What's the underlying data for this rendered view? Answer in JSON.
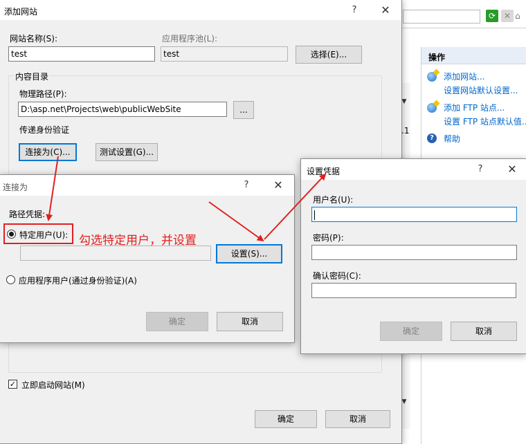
{
  "add_site": {
    "title": "添加网站",
    "help": "?",
    "close": "✕",
    "site_name_label": "网站名称(S):",
    "site_name_value": "test",
    "app_pool_label": "应用程序池(L):",
    "app_pool_value": "test",
    "select_button": "选择(E)...",
    "content_dir_label": "内容目录",
    "physical_path_label": "物理路径(P):",
    "physical_path_value": "D:\\asp.net\\Projects\\web\\publicWebSite",
    "browse_button": "...",
    "pass_auth_label": "传递身份验证",
    "connect_as_button": "连接为(C)...",
    "test_settings_button": "测试设置(G)...",
    "start_now_label": "立即启动网站(M)",
    "ok_button": "确定",
    "cancel_button": "取消"
  },
  "connect_as": {
    "title": "连接为",
    "help": "?",
    "close": "✕",
    "path_cred_label": "路径凭据:",
    "specific_user_label": "特定用户(U):",
    "set_button": "设置(S)...",
    "app_user_label": "应用程序用户(通过身份验证)(A)",
    "ok_button": "确定",
    "cancel_button": "取消"
  },
  "set_credentials": {
    "title": "设置凭据",
    "help": "?",
    "close": "✕",
    "username_label": "用户名(U):",
    "password_label": "密码(P):",
    "confirm_password_label": "确认密码(C):",
    "ok_button": "确定",
    "cancel_button": "取消"
  },
  "annotation": {
    "text": "勾选特定用户，并设置",
    "color": "#e02020"
  },
  "actions_pane": {
    "header": "操作",
    "add_site": "添加网站...",
    "set_site_defaults": "设置网站默认设置...",
    "add_ftp": "添加 FTP 站点...",
    "set_ftp_defaults": "设置 FTP 站点默认值...",
    "help": "帮助"
  },
  "background": {
    "fragment_text": ".1"
  }
}
